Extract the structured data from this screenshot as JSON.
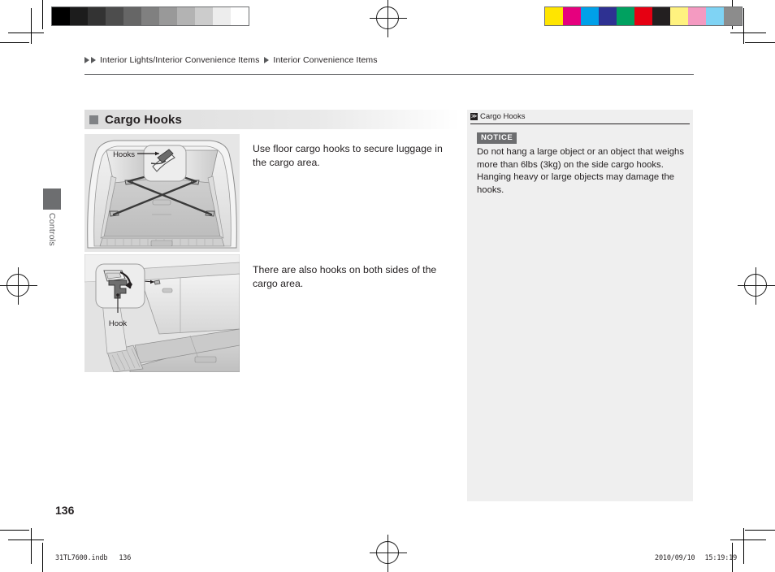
{
  "page": {
    "number": "136",
    "chapter_tab_label": "Controls"
  },
  "breadcrumb": {
    "arrow_icon": "triangle-right-icon",
    "first": "Interior Lights/Interior Convenience Items",
    "second": "Interior Convenience Items"
  },
  "section": {
    "bullet_icon": "square-bullet-icon",
    "title": "Cargo Hooks"
  },
  "figures": [
    {
      "name": "cargo-area-floor-hooks-figure",
      "caption_label": "Hooks",
      "alt": "Rear cargo area of vehicle with floor cargo hooks and crossed straps"
    },
    {
      "name": "side-cargo-hook-figure",
      "caption_label": "Hook",
      "alt": "Close-up detail of a folding side cargo hook being rotated down"
    }
  ],
  "main": {
    "paragraph_1": "Use floor cargo hooks to secure luggage in the cargo area.",
    "paragraph_2": "There are also hooks on both sides of the cargo area."
  },
  "sidebar": {
    "icon": "double-chevron-icon",
    "icon_glyph": "≫",
    "title": "Cargo Hooks",
    "notice_label": "NOTICE",
    "notice_text": "Do not hang a large object or an object that weighs more than 6lbs (3kg) on the side cargo hooks. Hanging heavy or large objects may damage the hooks."
  },
  "footer": {
    "file_name": "31TL7600.indb",
    "file_page": "136",
    "date": "2010/09/10",
    "time": "15:19:19"
  },
  "print_marks": {
    "grayscale_bar": [
      "#000000",
      "#1c1c1c",
      "#333333",
      "#4d4d4d",
      "#666666",
      "#808080",
      "#999999",
      "#b3b3b3",
      "#cccccc",
      "#ededed",
      "#ffffff"
    ],
    "color_bar": [
      "#ffe500",
      "#e6007e",
      "#00a0e9",
      "#2e3192",
      "#00a160",
      "#e60012",
      "#231f20",
      "#fff27f",
      "#f49ac1",
      "#7fd3f4",
      "#8c8c8c"
    ],
    "registration_icon": "registration-cross-icon"
  },
  "colors": {
    "ink": "#231f20",
    "rule": "#58595b",
    "sidebar_bg": "#efefef",
    "heading_bg": "#dcdcdc",
    "badge_bg": "#6d6e70",
    "figure_bg": "#e8e8e8"
  }
}
